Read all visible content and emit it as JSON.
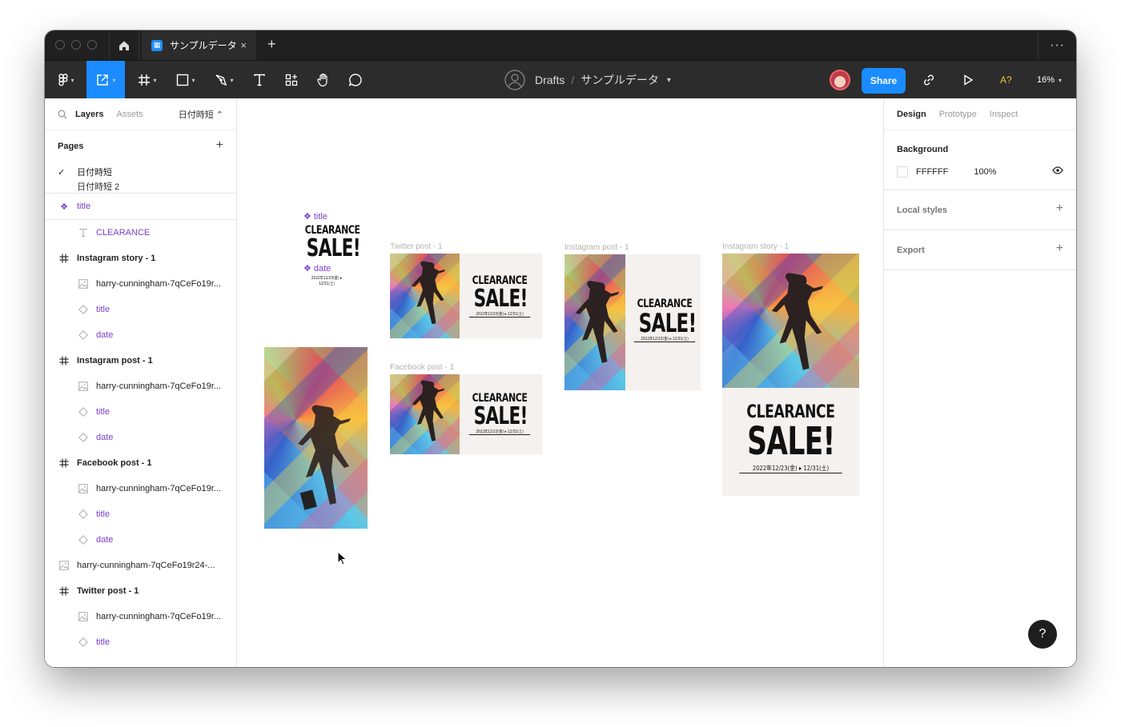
{
  "window": {
    "tab_title": "サンプルデータ",
    "close_glyph": "×",
    "newtab_glyph": "+",
    "more_glyph": "···"
  },
  "toolbar": {
    "breadcrumb_team": "Drafts",
    "breadcrumb_sep": "/",
    "file_name": "サンプルデータ",
    "share_label": "Share",
    "a11y_label": "A?",
    "zoom_label": "16%",
    "chev": "⌄"
  },
  "left_panel": {
    "tabs": {
      "layers": "Layers",
      "assets": "Assets",
      "page_selector": "日付時短 ⌃"
    },
    "pages_label": "Pages",
    "pages": [
      {
        "name": "日付時短",
        "selected": true
      },
      {
        "name": "日付時短 2",
        "selected": false
      }
    ],
    "layers": [
      {
        "name": "title",
        "type": "component",
        "indent": 0,
        "bold": false,
        "purple": true
      },
      {
        "name": "CLEARANCE",
        "type": "text",
        "indent": 1,
        "bold": false,
        "purple": true
      },
      {
        "name": "Instagram story - 1",
        "type": "frame",
        "indent": 0,
        "bold": true,
        "purple": false
      },
      {
        "name": "harry-cunningham-7qCeFo19r...",
        "type": "image",
        "indent": 1,
        "bold": false,
        "purple": false
      },
      {
        "name": "title",
        "type": "instance",
        "indent": 1,
        "bold": false,
        "purple": true
      },
      {
        "name": "date",
        "type": "instance",
        "indent": 1,
        "bold": false,
        "purple": true
      },
      {
        "name": "Instagram post - 1",
        "type": "frame",
        "indent": 0,
        "bold": true,
        "purple": false
      },
      {
        "name": "harry-cunningham-7qCeFo19r...",
        "type": "image",
        "indent": 1,
        "bold": false,
        "purple": false
      },
      {
        "name": "title",
        "type": "instance",
        "indent": 1,
        "bold": false,
        "purple": true
      },
      {
        "name": "date",
        "type": "instance",
        "indent": 1,
        "bold": false,
        "purple": true
      },
      {
        "name": "Facebook post - 1",
        "type": "frame",
        "indent": 0,
        "bold": true,
        "purple": false
      },
      {
        "name": "harry-cunningham-7qCeFo19r...",
        "type": "image",
        "indent": 1,
        "bold": false,
        "purple": false
      },
      {
        "name": "title",
        "type": "instance",
        "indent": 1,
        "bold": false,
        "purple": true
      },
      {
        "name": "date",
        "type": "instance",
        "indent": 1,
        "bold": false,
        "purple": true
      },
      {
        "name": "harry-cunningham-7qCeFo19r24-...",
        "type": "image",
        "indent": 0,
        "bold": false,
        "purple": false
      },
      {
        "name": "Twitter post - 1",
        "type": "frame",
        "indent": 0,
        "bold": true,
        "purple": false
      },
      {
        "name": "harry-cunningham-7qCeFo19r...",
        "type": "image",
        "indent": 1,
        "bold": false,
        "purple": false
      },
      {
        "name": "title",
        "type": "instance",
        "indent": 1,
        "bold": false,
        "purple": true
      }
    ]
  },
  "right_panel": {
    "tabs": {
      "design": "Design",
      "prototype": "Prototype",
      "inspect": "Inspect"
    },
    "background_label": "Background",
    "background_hex": "FFFFFF",
    "background_opacity": "100%",
    "local_styles_label": "Local styles",
    "export_label": "Export"
  },
  "canvas": {
    "components": {
      "title": "title",
      "date": "date"
    },
    "frames": {
      "twitter": "Twitter post - 1",
      "facebook": "Facebook post - 1",
      "instagram_post": "Instagram post - 1",
      "instagram_story": "Instagram story - 1"
    },
    "art": {
      "line1": "CLEARANCE",
      "line2": "SALE!",
      "date": "2022年12/23(金) ▸ 12/31(土)"
    }
  },
  "help_label": "?",
  "colors": {
    "accent": "#1a8cff",
    "component": "#7b3fc9",
    "toolbar": "#2c2c2c"
  }
}
